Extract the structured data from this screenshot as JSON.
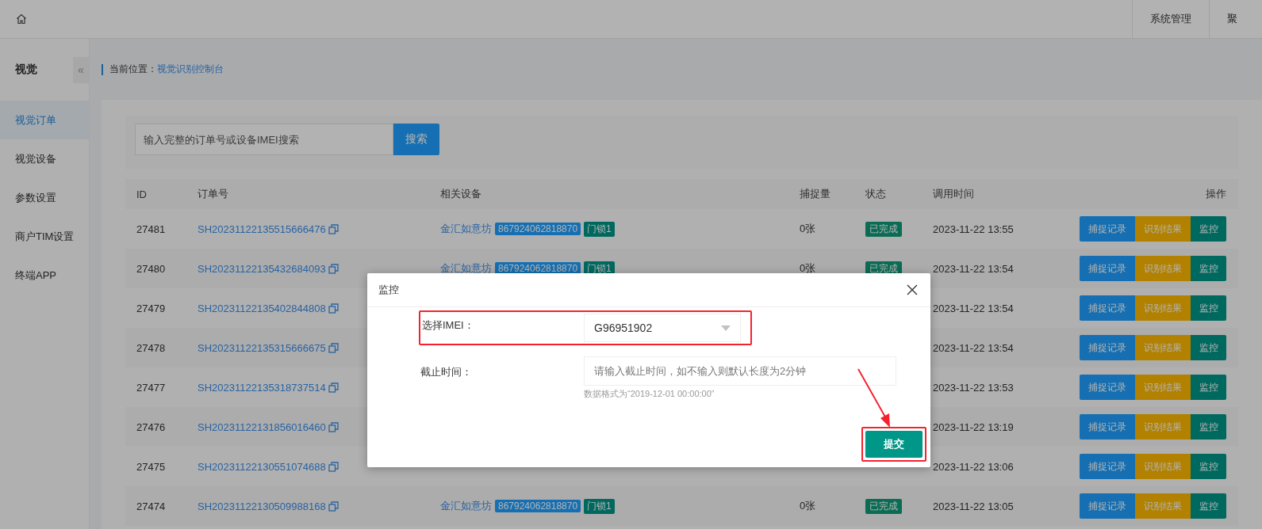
{
  "topbar": {
    "nav": [
      {
        "label": "系统管理"
      },
      {
        "label": "聚"
      }
    ]
  },
  "sidebar": {
    "title": "视觉",
    "collapse": "«",
    "items": [
      {
        "label": "视觉订单",
        "selected": true
      },
      {
        "label": "视觉设备",
        "selected": false
      },
      {
        "label": "参数设置",
        "selected": false
      },
      {
        "label": "商户TIM设置",
        "selected": false
      },
      {
        "label": "终端APP",
        "selected": false
      }
    ]
  },
  "breadcrumb": {
    "label": "当前位置：",
    "current": "视觉识别控制台"
  },
  "search": {
    "placeholder": "输入完整的订单号或设备IMEI搜索",
    "button": "搜索"
  },
  "table": {
    "columns": [
      "ID",
      "订单号",
      "相关设备",
      "捕捉量",
      "状态",
      "调用时间",
      "操作"
    ],
    "rows": [
      {
        "id": "27481",
        "order_no": "SH20231122135515666476",
        "device": {
          "name": "金汇如意坊",
          "imei": "867924062818870",
          "lock": "门锁1"
        },
        "count": "0张",
        "status": "已完成",
        "time": "2023-11-22 13:55",
        "actions": [
          {
            "kind": "capture",
            "label": "捕捉记录"
          },
          {
            "kind": "result",
            "label": "识别结果"
          },
          {
            "kind": "monitor",
            "label": "监控"
          }
        ]
      },
      {
        "id": "27480",
        "order_no": "SH20231122135432684093",
        "device": {
          "name": "金汇如意坊",
          "imei": "867924062818870",
          "lock": "门锁1"
        },
        "count": "0张",
        "status": "已完成",
        "time": "2023-11-22 13:54",
        "actions": [
          {
            "kind": "capture",
            "label": "捕捉记录"
          },
          {
            "kind": "result",
            "label": "识别结果"
          },
          {
            "kind": "monitor",
            "label": "监控"
          }
        ]
      },
      {
        "id": "27479",
        "order_no": "SH20231122135402844808",
        "time": "2023-11-22 13:54",
        "actions": [
          {
            "kind": "capture",
            "label": "捕捉记录"
          },
          {
            "kind": "result",
            "label": "识别结果"
          },
          {
            "kind": "monitor",
            "label": "监控"
          }
        ]
      },
      {
        "id": "27478",
        "order_no": "SH20231122135315666675",
        "time": "2023-11-22 13:54",
        "actions": [
          {
            "kind": "capture",
            "label": "捕捉记录"
          },
          {
            "kind": "result",
            "label": "识别结果"
          },
          {
            "kind": "monitor",
            "label": "监控"
          }
        ]
      },
      {
        "id": "27477",
        "order_no": "SH20231122135318737514",
        "time": "2023-11-22 13:53",
        "actions": [
          {
            "kind": "capture",
            "label": "捕捉记录"
          },
          {
            "kind": "result",
            "label": "识别结果"
          },
          {
            "kind": "monitor",
            "label": "监控"
          }
        ]
      },
      {
        "id": "27476",
        "order_no": "SH20231122131856016460",
        "time": "2023-11-22 13:19",
        "actions": [
          {
            "kind": "capture",
            "label": "捕捉记录"
          },
          {
            "kind": "result",
            "label": "识别结果"
          },
          {
            "kind": "monitor",
            "label": "监控"
          }
        ]
      },
      {
        "id": "27475",
        "order_no": "SH20231122130551074688",
        "time": "2023-11-22 13:06",
        "actions": [
          {
            "kind": "capture",
            "label": "捕捉记录"
          },
          {
            "kind": "result",
            "label": "识别结果"
          },
          {
            "kind": "monitor",
            "label": "监控"
          }
        ]
      },
      {
        "id": "27474",
        "order_no": "SH20231122130509988168",
        "device": {
          "name": "金汇如意坊",
          "imei": "867924062818870",
          "lock": "门锁1"
        },
        "count": "0张",
        "status": "已完成",
        "time": "2023-11-22 13:05",
        "actions": [
          {
            "kind": "capture",
            "label": "捕捉记录"
          },
          {
            "kind": "result",
            "label": "识别结果"
          },
          {
            "kind": "monitor",
            "label": "监控"
          }
        ]
      }
    ]
  },
  "modal": {
    "title": "监控",
    "fields": [
      {
        "kind": "select",
        "label": "选择IMEI：",
        "value": "G96951902",
        "highlighted": true
      },
      {
        "kind": "input",
        "label": "截止时间：",
        "placeholder": "请输入截止时间，如不输入则默认长度为2分钟",
        "hint": "数据格式为“2019-12-01 00:00:00”",
        "highlighted": false
      }
    ],
    "submit": {
      "label": "提交",
      "highlighted": true
    }
  }
}
